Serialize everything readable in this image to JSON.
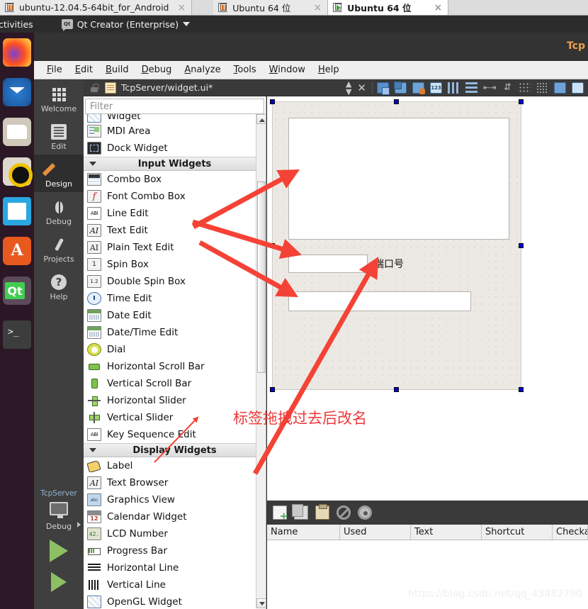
{
  "vm_tabs": [
    {
      "label": "ubuntu-12.04.5-64bit_for_Android",
      "icon": "vm-suspended-icon",
      "active": false,
      "close": "×"
    },
    {
      "label": "Ubuntu 64 位",
      "icon": "vm-suspended-icon",
      "active": false,
      "close": "×"
    },
    {
      "label": "Ubuntu 64 位",
      "icon": "vm-running-icon",
      "active": true,
      "close": "×"
    }
  ],
  "ubuntu_bar": {
    "activities": "ctivities",
    "app_name": "Qt Creator (Enterprise)",
    "app_icon": "qt-icon",
    "caret": "caret-down-icon"
  },
  "dock": {
    "items": [
      {
        "name": "firefox",
        "label": "Firefox"
      },
      {
        "name": "thunderbird",
        "label": "Thunderbird"
      },
      {
        "name": "files",
        "label": "Files"
      },
      {
        "name": "rhythmbox",
        "label": "Rhythmbox"
      },
      {
        "name": "libreoffice-writer",
        "label": "LibreOffice Writer"
      },
      {
        "name": "ubuntu-software",
        "label": "Ubuntu Software"
      },
      {
        "name": "qt-creator",
        "label": "Qt Creator"
      },
      {
        "name": "terminal",
        "label": "Terminal"
      }
    ]
  },
  "window": {
    "title": "Tcp"
  },
  "menu": {
    "items": [
      {
        "label": "File",
        "mnemonic": "F"
      },
      {
        "label": "Edit",
        "mnemonic": "E"
      },
      {
        "label": "Build",
        "mnemonic": "B"
      },
      {
        "label": "Debug",
        "mnemonic": "D"
      },
      {
        "label": "Analyze",
        "mnemonic": "A"
      },
      {
        "label": "Tools",
        "mnemonic": "T"
      },
      {
        "label": "Window",
        "mnemonic": "W"
      },
      {
        "label": "Help",
        "mnemonic": "H"
      }
    ]
  },
  "modes": {
    "items": [
      {
        "label": "Welcome",
        "icon": "grid-icon",
        "active": false
      },
      {
        "label": "Edit",
        "icon": "document-icon",
        "active": false
      },
      {
        "label": "Design",
        "icon": "pencil-icon",
        "active": true
      },
      {
        "label": "Debug",
        "icon": "bug-icon",
        "active": false
      },
      {
        "label": "Projects",
        "icon": "wrench-icon",
        "active": false
      },
      {
        "label": "Help",
        "icon": "question-icon",
        "active": false
      }
    ],
    "run_zone": {
      "project": "TcpServer",
      "kit_label": "Debug",
      "target_icon": "monitor-icon",
      "run_icon": "play-icon",
      "debug_icon": "play-bug-icon"
    }
  },
  "editor_toolbar": {
    "lock_icon": "lock-icon",
    "file_icon": "ui-file-icon",
    "document_path": "TcpServer/widget.ui*",
    "split_icon": "updown-arrows-icon",
    "close_icon": "close-icon",
    "tools": [
      {
        "name": "edit-widgets-icon"
      },
      {
        "name": "edit-signals-slots-icon"
      },
      {
        "name": "edit-buddies-icon"
      },
      {
        "name": "edit-tab-order-icon"
      },
      {
        "name": "layout-horizontally-icon"
      },
      {
        "name": "layout-vertically-icon"
      },
      {
        "name": "layout-horizontal-splitter-icon"
      },
      {
        "name": "layout-vertical-splitter-icon"
      },
      {
        "name": "layout-form-icon"
      },
      {
        "name": "layout-grid-icon"
      },
      {
        "name": "break-layout-icon"
      },
      {
        "name": "adjust-size-icon"
      }
    ]
  },
  "widget_box": {
    "filter_placeholder": "Filter",
    "filter_value": "",
    "scrollbar": {
      "up_icon": "scroll-up-icon",
      "down_icon": "scroll-down-icon"
    },
    "groups": [
      {
        "type": "items",
        "items": [
          {
            "label": "Widget",
            "icon": "widget-icon",
            "clipped": true
          },
          {
            "label": "MDI Area",
            "icon": "mdi-area-icon"
          },
          {
            "label": "Dock Widget",
            "icon": "dock-widget-icon"
          }
        ]
      },
      {
        "type": "category",
        "label": "Input Widgets",
        "expander": "triangle-down-icon",
        "items": [
          {
            "label": "Combo Box",
            "icon": "combo-box-icon"
          },
          {
            "label": "Font Combo Box",
            "icon": "font-combo-box-icon"
          },
          {
            "label": "Line Edit",
            "icon": "line-edit-icon"
          },
          {
            "label": "Text Edit",
            "icon": "text-edit-icon"
          },
          {
            "label": "Plain Text Edit",
            "icon": "plain-text-edit-icon"
          },
          {
            "label": "Spin Box",
            "icon": "spin-box-icon"
          },
          {
            "label": "Double Spin Box",
            "icon": "double-spin-box-icon"
          },
          {
            "label": "Time Edit",
            "icon": "time-edit-icon"
          },
          {
            "label": "Date Edit",
            "icon": "date-edit-icon"
          },
          {
            "label": "Date/Time Edit",
            "icon": "date-time-edit-icon"
          },
          {
            "label": "Dial",
            "icon": "dial-icon"
          },
          {
            "label": "Horizontal Scroll Bar",
            "icon": "horizontal-scroll-bar-icon"
          },
          {
            "label": "Vertical Scroll Bar",
            "icon": "vertical-scroll-bar-icon"
          },
          {
            "label": "Horizontal Slider",
            "icon": "horizontal-slider-icon"
          },
          {
            "label": "Vertical Slider",
            "icon": "vertical-slider-icon"
          },
          {
            "label": "Key Sequence Edit",
            "icon": "key-sequence-edit-icon"
          }
        ]
      },
      {
        "type": "category",
        "label": "Display Widgets",
        "expander": "triangle-down-icon",
        "items": [
          {
            "label": "Label",
            "icon": "label-icon"
          },
          {
            "label": "Text Browser",
            "icon": "text-browser-icon"
          },
          {
            "label": "Graphics View",
            "icon": "graphics-view-icon"
          },
          {
            "label": "Calendar Widget",
            "icon": "calendar-widget-icon"
          },
          {
            "label": "LCD Number",
            "icon": "lcd-number-icon"
          },
          {
            "label": "Progress Bar",
            "icon": "progress-bar-icon"
          },
          {
            "label": "Horizontal Line",
            "icon": "horizontal-line-icon"
          },
          {
            "label": "Vertical Line",
            "icon": "vertical-line-icon"
          },
          {
            "label": "OpenGL Widget",
            "icon": "opengl-widget-icon"
          }
        ]
      }
    ]
  },
  "form_canvas": {
    "selected": true,
    "widgets": [
      {
        "name": "text-edit-widget",
        "type": "QTextEdit",
        "text": ""
      },
      {
        "name": "line-edit-port",
        "type": "QLineEdit",
        "text": ""
      },
      {
        "name": "line-edit-message",
        "type": "QLineEdit",
        "text": ""
      },
      {
        "name": "label-port",
        "type": "QLabel",
        "text": "端口号"
      }
    ]
  },
  "annotation": {
    "text": "标签拖拽过去后改名",
    "color": "#ee3a3a",
    "arrows": 4
  },
  "action_editor": {
    "toolbar": [
      {
        "name": "new-action-icon"
      },
      {
        "name": "copy-icon"
      },
      {
        "name": "paste-icon"
      },
      {
        "name": "delete-icon"
      },
      {
        "name": "configure-icon"
      }
    ],
    "columns": [
      "Name",
      "Used",
      "Text",
      "Shortcut",
      "Checka"
    ],
    "rows": []
  },
  "watermark": "https://blog.csdn.net/qq_43482790",
  "colors": {
    "accent_orange": "#f0a04b",
    "annotation_red": "#ee3a3a",
    "handle_blue": "#0000d0",
    "form_bg": "#ece9e4",
    "dock_bg": "#2b1726"
  }
}
